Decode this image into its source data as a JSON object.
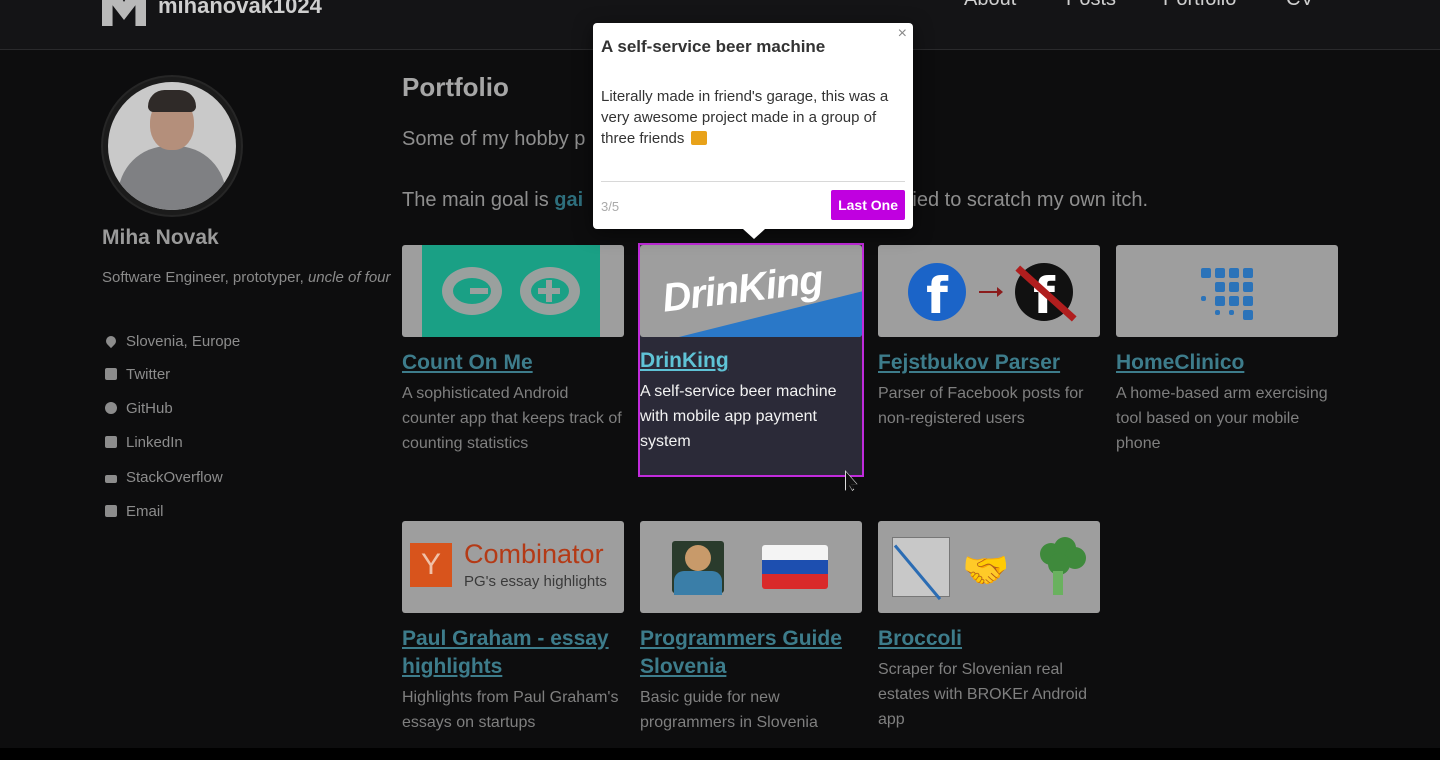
{
  "site": {
    "name": "mihanovak1024"
  },
  "nav": {
    "items": [
      "About",
      "Posts",
      "Portfolio",
      "CV"
    ]
  },
  "profile": {
    "name": "Miha Novak",
    "bio_plain": "Software Engineer, prototyper, ",
    "bio_italic": "uncle of four",
    "links": [
      {
        "label": "Slovenia, Europe",
        "icon": "location-pin-icon"
      },
      {
        "label": "Twitter",
        "icon": "twitter-icon"
      },
      {
        "label": "GitHub",
        "icon": "github-icon"
      },
      {
        "label": "LinkedIn",
        "icon": "linkedin-icon"
      },
      {
        "label": "StackOverflow",
        "icon": "stackoverflow-icon"
      },
      {
        "label": "Email",
        "icon": "email-icon"
      }
    ]
  },
  "main": {
    "title": "Portfolio",
    "intro_line1": "Some of my hobby p",
    "intro_line2_a": "The main goal is ",
    "intro_line2_hl": "gai",
    "intro_line2_b": "tried to scratch my own itch."
  },
  "projects": [
    {
      "title": "Count On Me",
      "desc": "A sophisticated Android counter app that keeps track of counting statistics"
    },
    {
      "title": "DrinKing",
      "desc": "A self-service beer machine with mobile app payment system",
      "thumb_text": "DrinKing"
    },
    {
      "title": "Fejstbukov Parser",
      "desc": "Parser of Facebook posts for non-registered users"
    },
    {
      "title": "HomeClinico",
      "desc": "A home-based arm exercising tool based on your mobile phone"
    },
    {
      "title": "Paul Graham - essay highlights",
      "desc": "Highlights from Paul Graham's essays on startups",
      "thumb_text_1": "Combinator",
      "thumb_text_2": "PG's essay highlights",
      "thumb_y": "Y"
    },
    {
      "title": "Programmers Guide Slovenia",
      "desc": "Basic guide for new programmers in Slovenia"
    },
    {
      "title": "Broccoli",
      "desc": "Scraper for Slovenian real estates with BROKEr Android app"
    }
  ],
  "popover": {
    "title": "A self-service beer machine",
    "body": "Literally made in friend's garage, this was a very awesome project made in a group of three friends",
    "progress": "3/5",
    "next_label": "Last One",
    "close_symbol": "×",
    "accent_color": "#c000e0"
  },
  "colors": {
    "background": "#0d0d0e",
    "link": "#3d7c8b",
    "highlight_border": "#c12bdc"
  }
}
